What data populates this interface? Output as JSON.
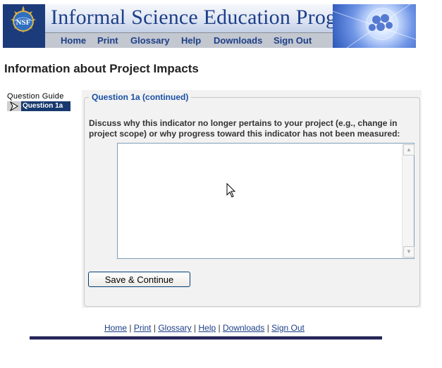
{
  "header": {
    "title": "Informal Science Education Program",
    "logo_text": "NSF",
    "nav": [
      "Home",
      "Print",
      "Glossary",
      "Help",
      "Downloads",
      "Sign Out"
    ]
  },
  "page": {
    "title": "Information about Project Impacts"
  },
  "sidebar": {
    "label": "Question Guide",
    "items": [
      {
        "label": "Question 1a",
        "icon": "arrow-pointer-icon"
      }
    ]
  },
  "form": {
    "legend": "Question 1a (continued)",
    "prompt": "Discuss why this indicator no longer pertains to your project (e.g., change in project scope) or why progress toward this indicator has not been measured:",
    "answer_value": "",
    "save_label": "Save & Continue"
  },
  "footer": {
    "links": [
      "Home",
      "Print",
      "Glossary",
      "Help",
      "Downloads",
      "Sign Out"
    ],
    "separator": "|"
  },
  "colors": {
    "brand_blue": "#1c3b7a",
    "legend_blue": "#1a4fa3",
    "panel_bg": "#f2f2f2",
    "footer_bar": "#242455"
  }
}
